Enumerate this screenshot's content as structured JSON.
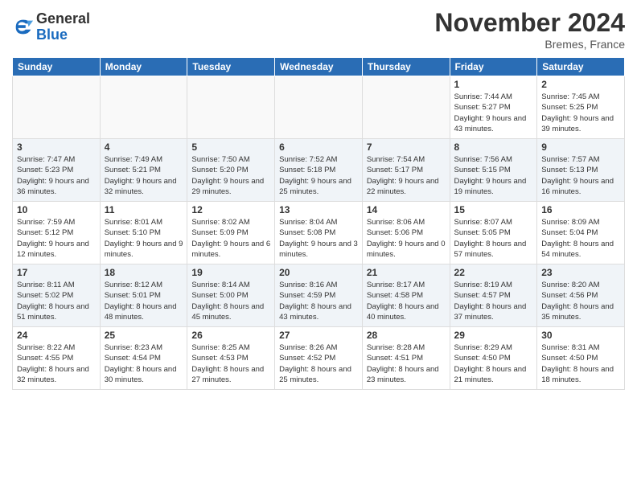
{
  "header": {
    "logo_general": "General",
    "logo_blue": "Blue",
    "month_title": "November 2024",
    "location": "Bremes, France"
  },
  "weekdays": [
    "Sunday",
    "Monday",
    "Tuesday",
    "Wednesday",
    "Thursday",
    "Friday",
    "Saturday"
  ],
  "weeks": [
    [
      {
        "day": "",
        "info": ""
      },
      {
        "day": "",
        "info": ""
      },
      {
        "day": "",
        "info": ""
      },
      {
        "day": "",
        "info": ""
      },
      {
        "day": "",
        "info": ""
      },
      {
        "day": "1",
        "info": "Sunrise: 7:44 AM\nSunset: 5:27 PM\nDaylight: 9 hours and 43 minutes."
      },
      {
        "day": "2",
        "info": "Sunrise: 7:45 AM\nSunset: 5:25 PM\nDaylight: 9 hours and 39 minutes."
      }
    ],
    [
      {
        "day": "3",
        "info": "Sunrise: 7:47 AM\nSunset: 5:23 PM\nDaylight: 9 hours and 36 minutes."
      },
      {
        "day": "4",
        "info": "Sunrise: 7:49 AM\nSunset: 5:21 PM\nDaylight: 9 hours and 32 minutes."
      },
      {
        "day": "5",
        "info": "Sunrise: 7:50 AM\nSunset: 5:20 PM\nDaylight: 9 hours and 29 minutes."
      },
      {
        "day": "6",
        "info": "Sunrise: 7:52 AM\nSunset: 5:18 PM\nDaylight: 9 hours and 25 minutes."
      },
      {
        "day": "7",
        "info": "Sunrise: 7:54 AM\nSunset: 5:17 PM\nDaylight: 9 hours and 22 minutes."
      },
      {
        "day": "8",
        "info": "Sunrise: 7:56 AM\nSunset: 5:15 PM\nDaylight: 9 hours and 19 minutes."
      },
      {
        "day": "9",
        "info": "Sunrise: 7:57 AM\nSunset: 5:13 PM\nDaylight: 9 hours and 16 minutes."
      }
    ],
    [
      {
        "day": "10",
        "info": "Sunrise: 7:59 AM\nSunset: 5:12 PM\nDaylight: 9 hours and 12 minutes."
      },
      {
        "day": "11",
        "info": "Sunrise: 8:01 AM\nSunset: 5:10 PM\nDaylight: 9 hours and 9 minutes."
      },
      {
        "day": "12",
        "info": "Sunrise: 8:02 AM\nSunset: 5:09 PM\nDaylight: 9 hours and 6 minutes."
      },
      {
        "day": "13",
        "info": "Sunrise: 8:04 AM\nSunset: 5:08 PM\nDaylight: 9 hours and 3 minutes."
      },
      {
        "day": "14",
        "info": "Sunrise: 8:06 AM\nSunset: 5:06 PM\nDaylight: 9 hours and 0 minutes."
      },
      {
        "day": "15",
        "info": "Sunrise: 8:07 AM\nSunset: 5:05 PM\nDaylight: 8 hours and 57 minutes."
      },
      {
        "day": "16",
        "info": "Sunrise: 8:09 AM\nSunset: 5:04 PM\nDaylight: 8 hours and 54 minutes."
      }
    ],
    [
      {
        "day": "17",
        "info": "Sunrise: 8:11 AM\nSunset: 5:02 PM\nDaylight: 8 hours and 51 minutes."
      },
      {
        "day": "18",
        "info": "Sunrise: 8:12 AM\nSunset: 5:01 PM\nDaylight: 8 hours and 48 minutes."
      },
      {
        "day": "19",
        "info": "Sunrise: 8:14 AM\nSunset: 5:00 PM\nDaylight: 8 hours and 45 minutes."
      },
      {
        "day": "20",
        "info": "Sunrise: 8:16 AM\nSunset: 4:59 PM\nDaylight: 8 hours and 43 minutes."
      },
      {
        "day": "21",
        "info": "Sunrise: 8:17 AM\nSunset: 4:58 PM\nDaylight: 8 hours and 40 minutes."
      },
      {
        "day": "22",
        "info": "Sunrise: 8:19 AM\nSunset: 4:57 PM\nDaylight: 8 hours and 37 minutes."
      },
      {
        "day": "23",
        "info": "Sunrise: 8:20 AM\nSunset: 4:56 PM\nDaylight: 8 hours and 35 minutes."
      }
    ],
    [
      {
        "day": "24",
        "info": "Sunrise: 8:22 AM\nSunset: 4:55 PM\nDaylight: 8 hours and 32 minutes."
      },
      {
        "day": "25",
        "info": "Sunrise: 8:23 AM\nSunset: 4:54 PM\nDaylight: 8 hours and 30 minutes."
      },
      {
        "day": "26",
        "info": "Sunrise: 8:25 AM\nSunset: 4:53 PM\nDaylight: 8 hours and 27 minutes."
      },
      {
        "day": "27",
        "info": "Sunrise: 8:26 AM\nSunset: 4:52 PM\nDaylight: 8 hours and 25 minutes."
      },
      {
        "day": "28",
        "info": "Sunrise: 8:28 AM\nSunset: 4:51 PM\nDaylight: 8 hours and 23 minutes."
      },
      {
        "day": "29",
        "info": "Sunrise: 8:29 AM\nSunset: 4:50 PM\nDaylight: 8 hours and 21 minutes."
      },
      {
        "day": "30",
        "info": "Sunrise: 8:31 AM\nSunset: 4:50 PM\nDaylight: 8 hours and 18 minutes."
      }
    ]
  ]
}
